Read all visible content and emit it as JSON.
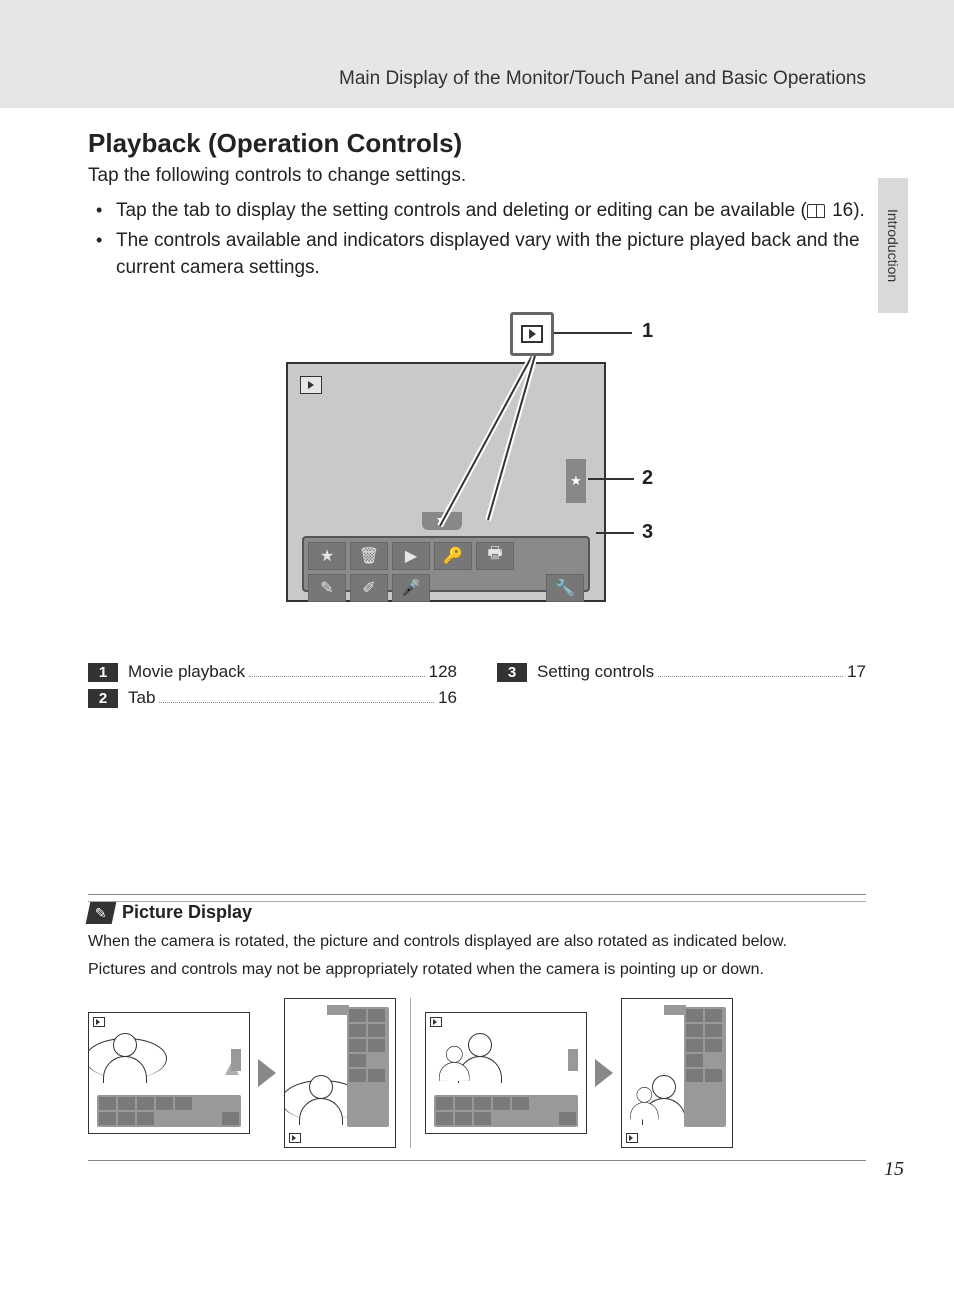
{
  "header": {
    "title": "Main Display of the Monitor/Touch Panel and Basic Operations"
  },
  "side_tab": "Introduction",
  "section": {
    "heading": "Playback (Operation Controls)",
    "intro": "Tap the following controls to change settings.",
    "bullets": [
      {
        "pre": "Tap the tab to display the setting controls and deleting or editing can be available (",
        "ref": "16",
        "post": ")."
      },
      {
        "text": "The controls available and indicators displayed vary with the picture played back and the current camera settings."
      }
    ]
  },
  "callouts": {
    "c1": "1",
    "c2": "2",
    "c3": "3"
  },
  "legend": {
    "left": [
      {
        "num": "1",
        "label": "Movie playback",
        "page": "128"
      },
      {
        "num": "2",
        "label": "Tab",
        "page": "16"
      }
    ],
    "right": [
      {
        "num": "3",
        "label": "Setting controls",
        "page": "17"
      }
    ]
  },
  "note": {
    "title": "Picture Display",
    "p1": "When the camera is rotated, the picture and controls displayed are also rotated as indicated below.",
    "p2": "Pictures and controls may not be appropriately rotated when the camera is pointing up or down."
  },
  "page_number": "15",
  "diagram_icons": {
    "row1": [
      "rating-icon",
      "trash-icon",
      "slideshow-icon",
      "protect-icon",
      "print-icon"
    ],
    "row2": [
      "paint-icon",
      "retouch-icon",
      "voice-memo-icon",
      "setup-icon"
    ]
  }
}
